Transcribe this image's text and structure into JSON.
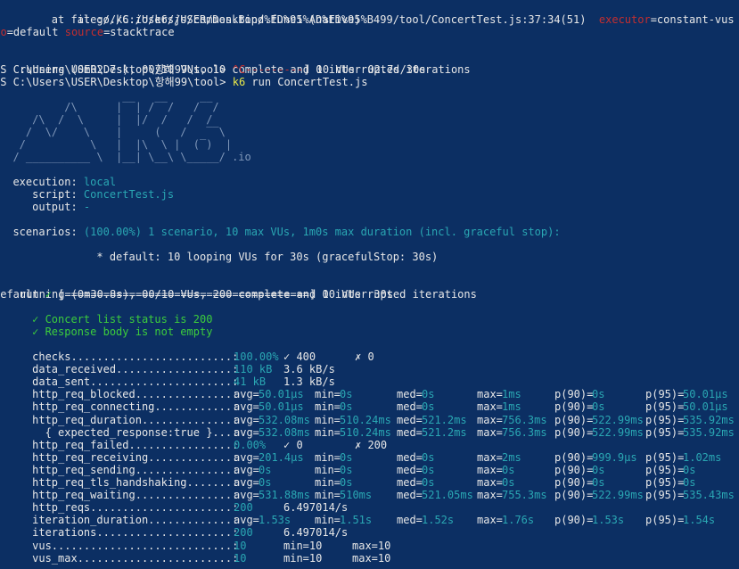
{
  "colors": {
    "background": "#0c2f63",
    "text": "#e8e8e8",
    "cyan": "#2aa7b3",
    "yellow": "#e8e84a",
    "red": "#c42f2f",
    "green": "#3ccd3c"
  },
  "stack": {
    "line1": "        at go.k6.io/k6/js/common.Bind.func1 (native)",
    "line2a": "        at file:///C:/Users/USER/Desktop/%ED%95%AD%ED%95%B499/tool/ConcertTest.js:37:34(51)  ",
    "line2b": "executor",
    "line2c": "=constant-vus ",
    "line2d": "scen",
    "line3a": "rio",
    "line3b": "=default ",
    "line3c": "source",
    "line3d": "=stacktrace"
  },
  "interrupted": {
    "line1": "running (0m02.7s), 00/10 VUs, 10 complete and 0 interrupted iterations",
    "line2a": "PS C:\\Users\\USER\\Desktop\\항해99\\tool> ",
    "line2b": "^C",
    "line2c": "---------",
    "line2d": "] 10 VUs  02.7s/30s",
    "line3a": "PS C:\\Users\\USER\\Desktop\\항해99\\tool> ",
    "line3b": "k6",
    "line3c": " run ConcertTest.js"
  },
  "logo": [
    "          /\\      |‾‾| /‾‾/   /‾‾/",
    "     /\\  /  \\     |  |/  /   /  /",
    "    /  \\/    \\    |     (   /   ‾‾\\",
    "   /          \\   |  |\\  \\ |  (‾)  |",
    "  / __________ \\  |__| \\__\\ \\_____/ .io"
  ],
  "execution": {
    "execution_label": "  execution: ",
    "execution_value": "local",
    "script_label": "     script: ",
    "script_value": "ConcertTest.js",
    "output_label": "     output: ",
    "output_value": "-",
    "scenarios_label": "  scenarios: ",
    "scenarios_value": "(100.00%) 1 scenario, 10 max VUs, 1m0s max duration (incl. graceful stop):",
    "default_line": "           * default: 10 looping VUs for 30s (gracefulStop: 30s)"
  },
  "final_run": {
    "line1": "running (0m30.8s), 00/10 VUs, 200 complete and 0 interrupted iterations",
    "line2a": "default ",
    "line2b": "✓",
    "line2c": " [======================================] 10 VUs  30s"
  },
  "checks_list": [
    "     ✓ Concert list status is 200",
    "     ✓ Response body is not empty"
  ],
  "metrics": [
    {
      "name": "     checks.........................: ",
      "cells": [
        {
          "text": "100.00%",
          "col": 262,
          "cls": "c"
        },
        {
          "text": "✓ 400",
          "col": 318,
          "cls": "w"
        },
        {
          "text": "✗ 0",
          "col": 398,
          "cls": "w"
        }
      ]
    },
    {
      "name": "     data_received..................: ",
      "cells": [
        {
          "text": "110 kB",
          "col": 262,
          "cls": "c"
        },
        {
          "text": "3.6 kB/s",
          "col": 318,
          "cls": "w"
        }
      ]
    },
    {
      "name": "     data_sent......................: ",
      "cells": [
        {
          "text": "41 kB",
          "col": 262,
          "cls": "c"
        },
        {
          "text": "1.3 kB/s",
          "col": 318,
          "cls": "w"
        }
      ]
    },
    {
      "name": "     http_req_blocked...............: ",
      "cells": [
        {
          "text": "avg=",
          "col": 262,
          "cls": "w"
        },
        {
          "text": "50.01µs",
          "col": 290,
          "cls": "c"
        },
        {
          "text": "min=",
          "col": 353,
          "cls": "w"
        },
        {
          "text": "0s",
          "col": 381,
          "cls": "c"
        },
        {
          "text": "med=",
          "col": 445,
          "cls": "w"
        },
        {
          "text": "0s",
          "col": 473,
          "cls": "c"
        },
        {
          "text": "max=",
          "col": 535,
          "cls": "w"
        },
        {
          "text": "1ms",
          "col": 563,
          "cls": "c"
        },
        {
          "text": "p(90)=",
          "col": 622,
          "cls": "w"
        },
        {
          "text": "0s",
          "col": 664,
          "cls": "c"
        },
        {
          "text": "p(95)=",
          "col": 724,
          "cls": "w"
        },
        {
          "text": "50.01µs",
          "col": 766,
          "cls": "c"
        }
      ]
    },
    {
      "name": "     http_req_connecting............: ",
      "cells": [
        {
          "text": "avg=",
          "col": 262,
          "cls": "w"
        },
        {
          "text": "50.01µs",
          "col": 290,
          "cls": "c"
        },
        {
          "text": "min=",
          "col": 353,
          "cls": "w"
        },
        {
          "text": "0s",
          "col": 381,
          "cls": "c"
        },
        {
          "text": "med=",
          "col": 445,
          "cls": "w"
        },
        {
          "text": "0s",
          "col": 473,
          "cls": "c"
        },
        {
          "text": "max=",
          "col": 535,
          "cls": "w"
        },
        {
          "text": "1ms",
          "col": 563,
          "cls": "c"
        },
        {
          "text": "p(90)=",
          "col": 622,
          "cls": "w"
        },
        {
          "text": "0s",
          "col": 664,
          "cls": "c"
        },
        {
          "text": "p(95)=",
          "col": 724,
          "cls": "w"
        },
        {
          "text": "50.01µs",
          "col": 766,
          "cls": "c"
        }
      ]
    },
    {
      "name": "     http_req_duration..............: ",
      "cells": [
        {
          "text": "avg=",
          "col": 262,
          "cls": "w"
        },
        {
          "text": "532.08ms",
          "col": 290,
          "cls": "c"
        },
        {
          "text": "min=",
          "col": 353,
          "cls": "w"
        },
        {
          "text": "510.24ms",
          "col": 381,
          "cls": "c"
        },
        {
          "text": "med=",
          "col": 445,
          "cls": "w"
        },
        {
          "text": "521.2ms",
          "col": 473,
          "cls": "c"
        },
        {
          "text": "max=",
          "col": 535,
          "cls": "w"
        },
        {
          "text": "756.3ms",
          "col": 563,
          "cls": "c"
        },
        {
          "text": "p(90)=",
          "col": 622,
          "cls": "w"
        },
        {
          "text": "522.99ms",
          "col": 664,
          "cls": "c"
        },
        {
          "text": "p(95)=",
          "col": 724,
          "cls": "w"
        },
        {
          "text": "535.92ms",
          "col": 766,
          "cls": "c"
        }
      ]
    },
    {
      "name": "       { expected_response:true }...: ",
      "cells": [
        {
          "text": "avg=",
          "col": 262,
          "cls": "w"
        },
        {
          "text": "532.08ms",
          "col": 290,
          "cls": "c"
        },
        {
          "text": "min=",
          "col": 353,
          "cls": "w"
        },
        {
          "text": "510.24ms",
          "col": 381,
          "cls": "c"
        },
        {
          "text": "med=",
          "col": 445,
          "cls": "w"
        },
        {
          "text": "521.2ms",
          "col": 473,
          "cls": "c"
        },
        {
          "text": "max=",
          "col": 535,
          "cls": "w"
        },
        {
          "text": "756.3ms",
          "col": 563,
          "cls": "c"
        },
        {
          "text": "p(90)=",
          "col": 622,
          "cls": "w"
        },
        {
          "text": "522.99ms",
          "col": 664,
          "cls": "c"
        },
        {
          "text": "p(95)=",
          "col": 724,
          "cls": "w"
        },
        {
          "text": "535.92ms",
          "col": 766,
          "cls": "c"
        }
      ]
    },
    {
      "name": "     http_req_failed................: ",
      "cells": [
        {
          "text": "0.00%",
          "col": 262,
          "cls": "c"
        },
        {
          "text": "✓ 0",
          "col": 318,
          "cls": "w"
        },
        {
          "text": "✗ 200",
          "col": 398,
          "cls": "w"
        }
      ]
    },
    {
      "name": "     http_req_receiving.............: ",
      "cells": [
        {
          "text": "avg=",
          "col": 262,
          "cls": "w"
        },
        {
          "text": "201.4µs",
          "col": 290,
          "cls": "c"
        },
        {
          "text": "min=",
          "col": 353,
          "cls": "w"
        },
        {
          "text": "0s",
          "col": 381,
          "cls": "c"
        },
        {
          "text": "med=",
          "col": 445,
          "cls": "w"
        },
        {
          "text": "0s",
          "col": 473,
          "cls": "c"
        },
        {
          "text": "max=",
          "col": 535,
          "cls": "w"
        },
        {
          "text": "2ms",
          "col": 563,
          "cls": "c"
        },
        {
          "text": "p(90)=",
          "col": 622,
          "cls": "w"
        },
        {
          "text": "999.9µs",
          "col": 664,
          "cls": "c"
        },
        {
          "text": "p(95)=",
          "col": 724,
          "cls": "w"
        },
        {
          "text": "1.02ms",
          "col": 766,
          "cls": "c"
        }
      ]
    },
    {
      "name": "     http_req_sending...............: ",
      "cells": [
        {
          "text": "avg=",
          "col": 262,
          "cls": "w"
        },
        {
          "text": "0s",
          "col": 290,
          "cls": "c"
        },
        {
          "text": "min=",
          "col": 353,
          "cls": "w"
        },
        {
          "text": "0s",
          "col": 381,
          "cls": "c"
        },
        {
          "text": "med=",
          "col": 445,
          "cls": "w"
        },
        {
          "text": "0s",
          "col": 473,
          "cls": "c"
        },
        {
          "text": "max=",
          "col": 535,
          "cls": "w"
        },
        {
          "text": "0s",
          "col": 563,
          "cls": "c"
        },
        {
          "text": "p(90)=",
          "col": 622,
          "cls": "w"
        },
        {
          "text": "0s",
          "col": 664,
          "cls": "c"
        },
        {
          "text": "p(95)=",
          "col": 724,
          "cls": "w"
        },
        {
          "text": "0s",
          "col": 766,
          "cls": "c"
        }
      ]
    },
    {
      "name": "     http_req_tls_handshaking.......: ",
      "cells": [
        {
          "text": "avg=",
          "col": 262,
          "cls": "w"
        },
        {
          "text": "0s",
          "col": 290,
          "cls": "c"
        },
        {
          "text": "min=",
          "col": 353,
          "cls": "w"
        },
        {
          "text": "0s",
          "col": 381,
          "cls": "c"
        },
        {
          "text": "med=",
          "col": 445,
          "cls": "w"
        },
        {
          "text": "0s",
          "col": 473,
          "cls": "c"
        },
        {
          "text": "max=",
          "col": 535,
          "cls": "w"
        },
        {
          "text": "0s",
          "col": 563,
          "cls": "c"
        },
        {
          "text": "p(90)=",
          "col": 622,
          "cls": "w"
        },
        {
          "text": "0s",
          "col": 664,
          "cls": "c"
        },
        {
          "text": "p(95)=",
          "col": 724,
          "cls": "w"
        },
        {
          "text": "0s",
          "col": 766,
          "cls": "c"
        }
      ]
    },
    {
      "name": "     http_req_waiting...............: ",
      "cells": [
        {
          "text": "avg=",
          "col": 262,
          "cls": "w"
        },
        {
          "text": "531.88ms",
          "col": 290,
          "cls": "c"
        },
        {
          "text": "min=",
          "col": 353,
          "cls": "w"
        },
        {
          "text": "510ms",
          "col": 381,
          "cls": "c"
        },
        {
          "text": "med=",
          "col": 445,
          "cls": "w"
        },
        {
          "text": "521.05ms",
          "col": 473,
          "cls": "c"
        },
        {
          "text": "max=",
          "col": 535,
          "cls": "w"
        },
        {
          "text": "755.3ms",
          "col": 563,
          "cls": "c"
        },
        {
          "text": "p(90)=",
          "col": 622,
          "cls": "w"
        },
        {
          "text": "522.99ms",
          "col": 664,
          "cls": "c"
        },
        {
          "text": "p(95)=",
          "col": 724,
          "cls": "w"
        },
        {
          "text": "535.43ms",
          "col": 766,
          "cls": "c"
        }
      ]
    },
    {
      "name": "     http_reqs......................: ",
      "cells": [
        {
          "text": "200",
          "col": 262,
          "cls": "c"
        },
        {
          "text": "6.497014/s",
          "col": 318,
          "cls": "w"
        }
      ]
    },
    {
      "name": "     iteration_duration.............: ",
      "cells": [
        {
          "text": "avg=",
          "col": 262,
          "cls": "w"
        },
        {
          "text": "1.53s",
          "col": 290,
          "cls": "c"
        },
        {
          "text": "min=",
          "col": 353,
          "cls": "w"
        },
        {
          "text": "1.51s",
          "col": 381,
          "cls": "c"
        },
        {
          "text": "med=",
          "col": 445,
          "cls": "w"
        },
        {
          "text": "1.52s",
          "col": 473,
          "cls": "c"
        },
        {
          "text": "max=",
          "col": 535,
          "cls": "w"
        },
        {
          "text": "1.76s",
          "col": 563,
          "cls": "c"
        },
        {
          "text": "p(90)=",
          "col": 622,
          "cls": "w"
        },
        {
          "text": "1.53s",
          "col": 664,
          "cls": "c"
        },
        {
          "text": "p(95)=",
          "col": 724,
          "cls": "w"
        },
        {
          "text": "1.54s",
          "col": 766,
          "cls": "c"
        }
      ]
    },
    {
      "name": "     iterations.....................: ",
      "cells": [
        {
          "text": "200",
          "col": 262,
          "cls": "c"
        },
        {
          "text": "6.497014/s",
          "col": 318,
          "cls": "w"
        }
      ]
    },
    {
      "name": "     vus............................: ",
      "cells": [
        {
          "text": "10",
          "col": 262,
          "cls": "c"
        },
        {
          "text": "min=10",
          "col": 318,
          "cls": "w"
        },
        {
          "text": "max=10",
          "col": 395,
          "cls": "w"
        }
      ]
    },
    {
      "name": "     vus_max........................: ",
      "cells": [
        {
          "text": "10",
          "col": 262,
          "cls": "c"
        },
        {
          "text": "min=10",
          "col": 318,
          "cls": "w"
        },
        {
          "text": "max=10",
          "col": 395,
          "cls": "w"
        }
      ]
    }
  ]
}
